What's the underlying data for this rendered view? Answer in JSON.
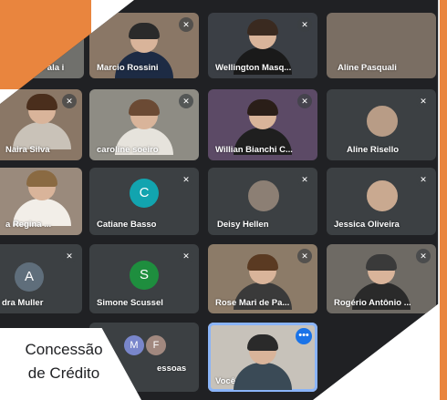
{
  "caption": {
    "line1": "Concessão",
    "line2": "de Crédito"
  },
  "colors": {
    "orange": "#e9853e",
    "meet_bg": "#202124",
    "tile_dark": "#3c4043",
    "selected_outline": "#8ab4f8"
  },
  "icons": {
    "muted": "mic-off-icon",
    "more": "more-options-icon"
  },
  "participants": [
    {
      "name": "Fala i"
    },
    {
      "name": "Marcio Rossini"
    },
    {
      "name": "Wellington Masq..."
    },
    {
      "name": "Aline Pasquali"
    },
    {
      "name": "Naira Silva"
    },
    {
      "name": "caroline soeiro"
    },
    {
      "name": "Willian Bianchi C..."
    },
    {
      "name": "Aline Risello"
    },
    {
      "name": "a Regina ..."
    },
    {
      "name": "Catiane Basso",
      "initial": "C"
    },
    {
      "name": "Deisy Hellen"
    },
    {
      "name": "Jessica Oliveira"
    },
    {
      "name": "dra Muller",
      "initial": "A"
    },
    {
      "name": "Simone Scussel",
      "initial": "S"
    },
    {
      "name": "Rose Mari de Pa..."
    },
    {
      "name": "Rogério Antônio ..."
    },
    {
      "name": "essoas",
      "initials": [
        "M",
        "F"
      ]
    },
    {
      "name": "Você"
    }
  ]
}
